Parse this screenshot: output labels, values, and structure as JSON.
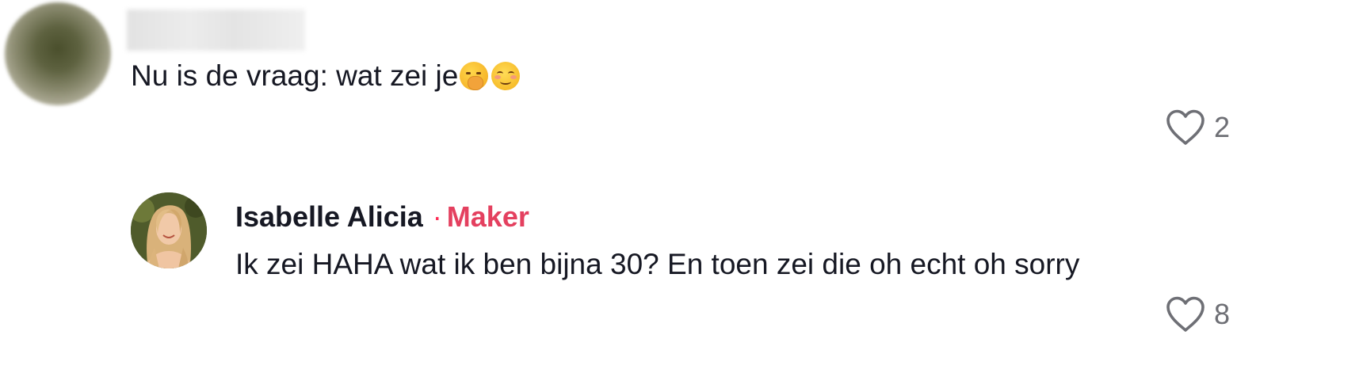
{
  "comments": [
    {
      "author": "",
      "text": "Nu is de vraag: wat zei je",
      "emojis": [
        "face-with-hand-over-mouth",
        "smiling-face"
      ],
      "likes": "2"
    }
  ],
  "reply": {
    "author": "Isabelle Alicia",
    "separator": "·",
    "badge": "Maker",
    "text": "Ik zei HAHA wat ik ben bijna 30? En toen zei die oh echt oh sorry",
    "likes": "8"
  },
  "colors": {
    "text": "#161823",
    "secondary": "#6e6f75",
    "creator_badge": "#e4405f"
  },
  "icons": {
    "like": "heart-outline-icon"
  }
}
